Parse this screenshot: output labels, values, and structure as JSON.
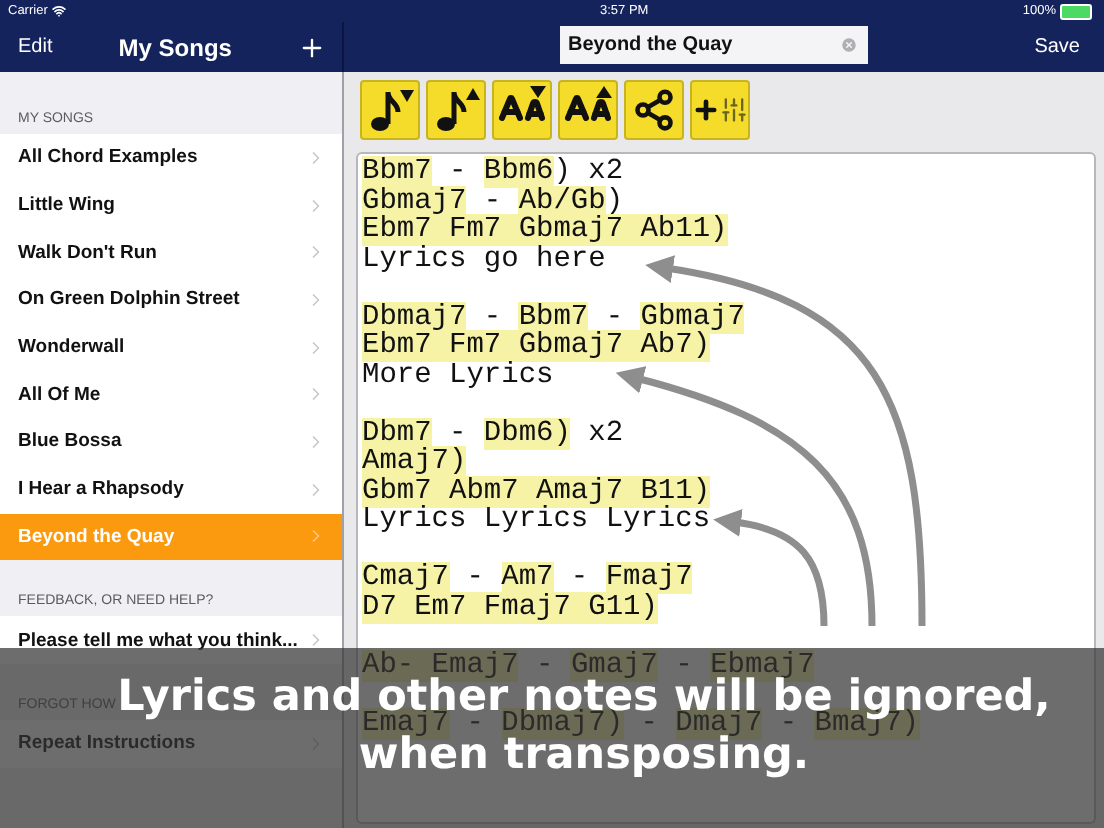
{
  "status_bar": {
    "carrier": "Carrier",
    "time": "3:57 PM",
    "battery": "100%"
  },
  "sidebar": {
    "edit": "Edit",
    "title": "My Songs",
    "sections": [
      {
        "header": "MY SONGS",
        "items": [
          {
            "label": "All Chord Examples",
            "selected": false
          },
          {
            "label": "Little Wing",
            "selected": false
          },
          {
            "label": "Walk Don't Run",
            "selected": false
          },
          {
            "label": "On Green Dolphin Street",
            "selected": false
          },
          {
            "label": "Wonderwall",
            "selected": false
          },
          {
            "label": "All Of Me",
            "selected": false
          },
          {
            "label": "Blue Bossa",
            "selected": false
          },
          {
            "label": "I Hear a Rhapsody",
            "selected": false
          },
          {
            "label": "Beyond the Quay",
            "selected": true
          }
        ]
      },
      {
        "header": "FEEDBACK, OR NEED HELP?",
        "items": [
          {
            "label": "Please tell me what you think...",
            "selected": false
          }
        ]
      },
      {
        "header": "FORGOT HOW",
        "items": [
          {
            "label": "Repeat Instructions",
            "selected": false
          }
        ]
      }
    ]
  },
  "editor": {
    "title": "Beyond the Quay",
    "save": "Save",
    "tools": [
      {
        "kind": "note-down"
      },
      {
        "kind": "note-up"
      },
      {
        "kind": "font-down"
      },
      {
        "kind": "font-up"
      },
      {
        "kind": "share"
      },
      {
        "kind": "add-settings"
      }
    ],
    "lines": [
      {
        "kind": "chords",
        "parts": [
          {
            "text": "Bbm7",
            "chord": true
          },
          {
            "text": " - ",
            "chord": false
          },
          {
            "text": "Bbm6",
            "chord": true
          },
          {
            "text": ") x2",
            "chord": false
          }
        ]
      },
      {
        "kind": "chords",
        "parts": [
          {
            "text": "Gbmaj7",
            "chord": true
          },
          {
            "text": " - ",
            "chord": false
          },
          {
            "text": "Ab/Gb",
            "chord": true
          },
          {
            "text": ")",
            "chord": false
          }
        ]
      },
      {
        "kind": "chords",
        "parts": [
          {
            "text": "Ebm7 Fm7 Gbmaj7 Ab11)",
            "chord": true
          }
        ]
      },
      {
        "kind": "lyrics",
        "text": "Lyrics go here"
      },
      {
        "kind": "blank"
      },
      {
        "kind": "chords",
        "parts": [
          {
            "text": "Dbmaj7",
            "chord": true
          },
          {
            "text": " - ",
            "chord": false
          },
          {
            "text": "Bbm7",
            "chord": true
          },
          {
            "text": " - ",
            "chord": false
          },
          {
            "text": "Gbmaj7",
            "chord": true
          }
        ]
      },
      {
        "kind": "chords",
        "parts": [
          {
            "text": "Ebm7 Fm7 Gbmaj7 Ab7)",
            "chord": true
          }
        ]
      },
      {
        "kind": "lyrics",
        "text": "More Lyrics"
      },
      {
        "kind": "blank"
      },
      {
        "kind": "chords",
        "parts": [
          {
            "text": "Dbm7",
            "chord": true
          },
          {
            "text": " - ",
            "chord": false
          },
          {
            "text": "Dbm6)",
            "chord": true
          },
          {
            "text": " x2",
            "chord": false
          }
        ]
      },
      {
        "kind": "chords",
        "parts": [
          {
            "text": "Amaj7)",
            "chord": true
          }
        ]
      },
      {
        "kind": "chords",
        "parts": [
          {
            "text": "Gbm7 Abm7 Amaj7 B11)",
            "chord": true
          }
        ]
      },
      {
        "kind": "lyrics",
        "text": "Lyrics Lyrics Lyrics"
      },
      {
        "kind": "blank"
      },
      {
        "kind": "chords",
        "parts": [
          {
            "text": "Cmaj7",
            "chord": true
          },
          {
            "text": " - ",
            "chord": false
          },
          {
            "text": "Am7",
            "chord": true
          },
          {
            "text": " - ",
            "chord": false
          },
          {
            "text": "Fmaj7",
            "chord": true
          }
        ]
      },
      {
        "kind": "chords",
        "parts": [
          {
            "text": "D7 Em7 Fmaj7 G11)",
            "chord": true
          }
        ]
      },
      {
        "kind": "blank"
      },
      {
        "kind": "chords",
        "parts": [
          {
            "text": "Ab- Emaj7",
            "chord": true
          },
          {
            "text": " - ",
            "chord": false
          },
          {
            "text": "Gmaj7",
            "chord": true
          },
          {
            "text": " - ",
            "chord": false
          },
          {
            "text": "Ebmaj7",
            "chord": true
          }
        ]
      },
      {
        "kind": "blank"
      },
      {
        "kind": "chords",
        "parts": [
          {
            "text": "Emaj7",
            "chord": true
          },
          {
            "text": " - ",
            "chord": false
          },
          {
            "text": "Dbmaj7)",
            "chord": true
          },
          {
            "text": " - ",
            "chord": false
          },
          {
            "text": "Dmaj7",
            "chord": true
          },
          {
            "text": " - ",
            "chord": false
          },
          {
            "text": "Bmaj7)",
            "chord": true
          }
        ]
      }
    ]
  },
  "caption_lines": [
    "Lyrics and other notes will be ignored,",
    "when transposing."
  ]
}
